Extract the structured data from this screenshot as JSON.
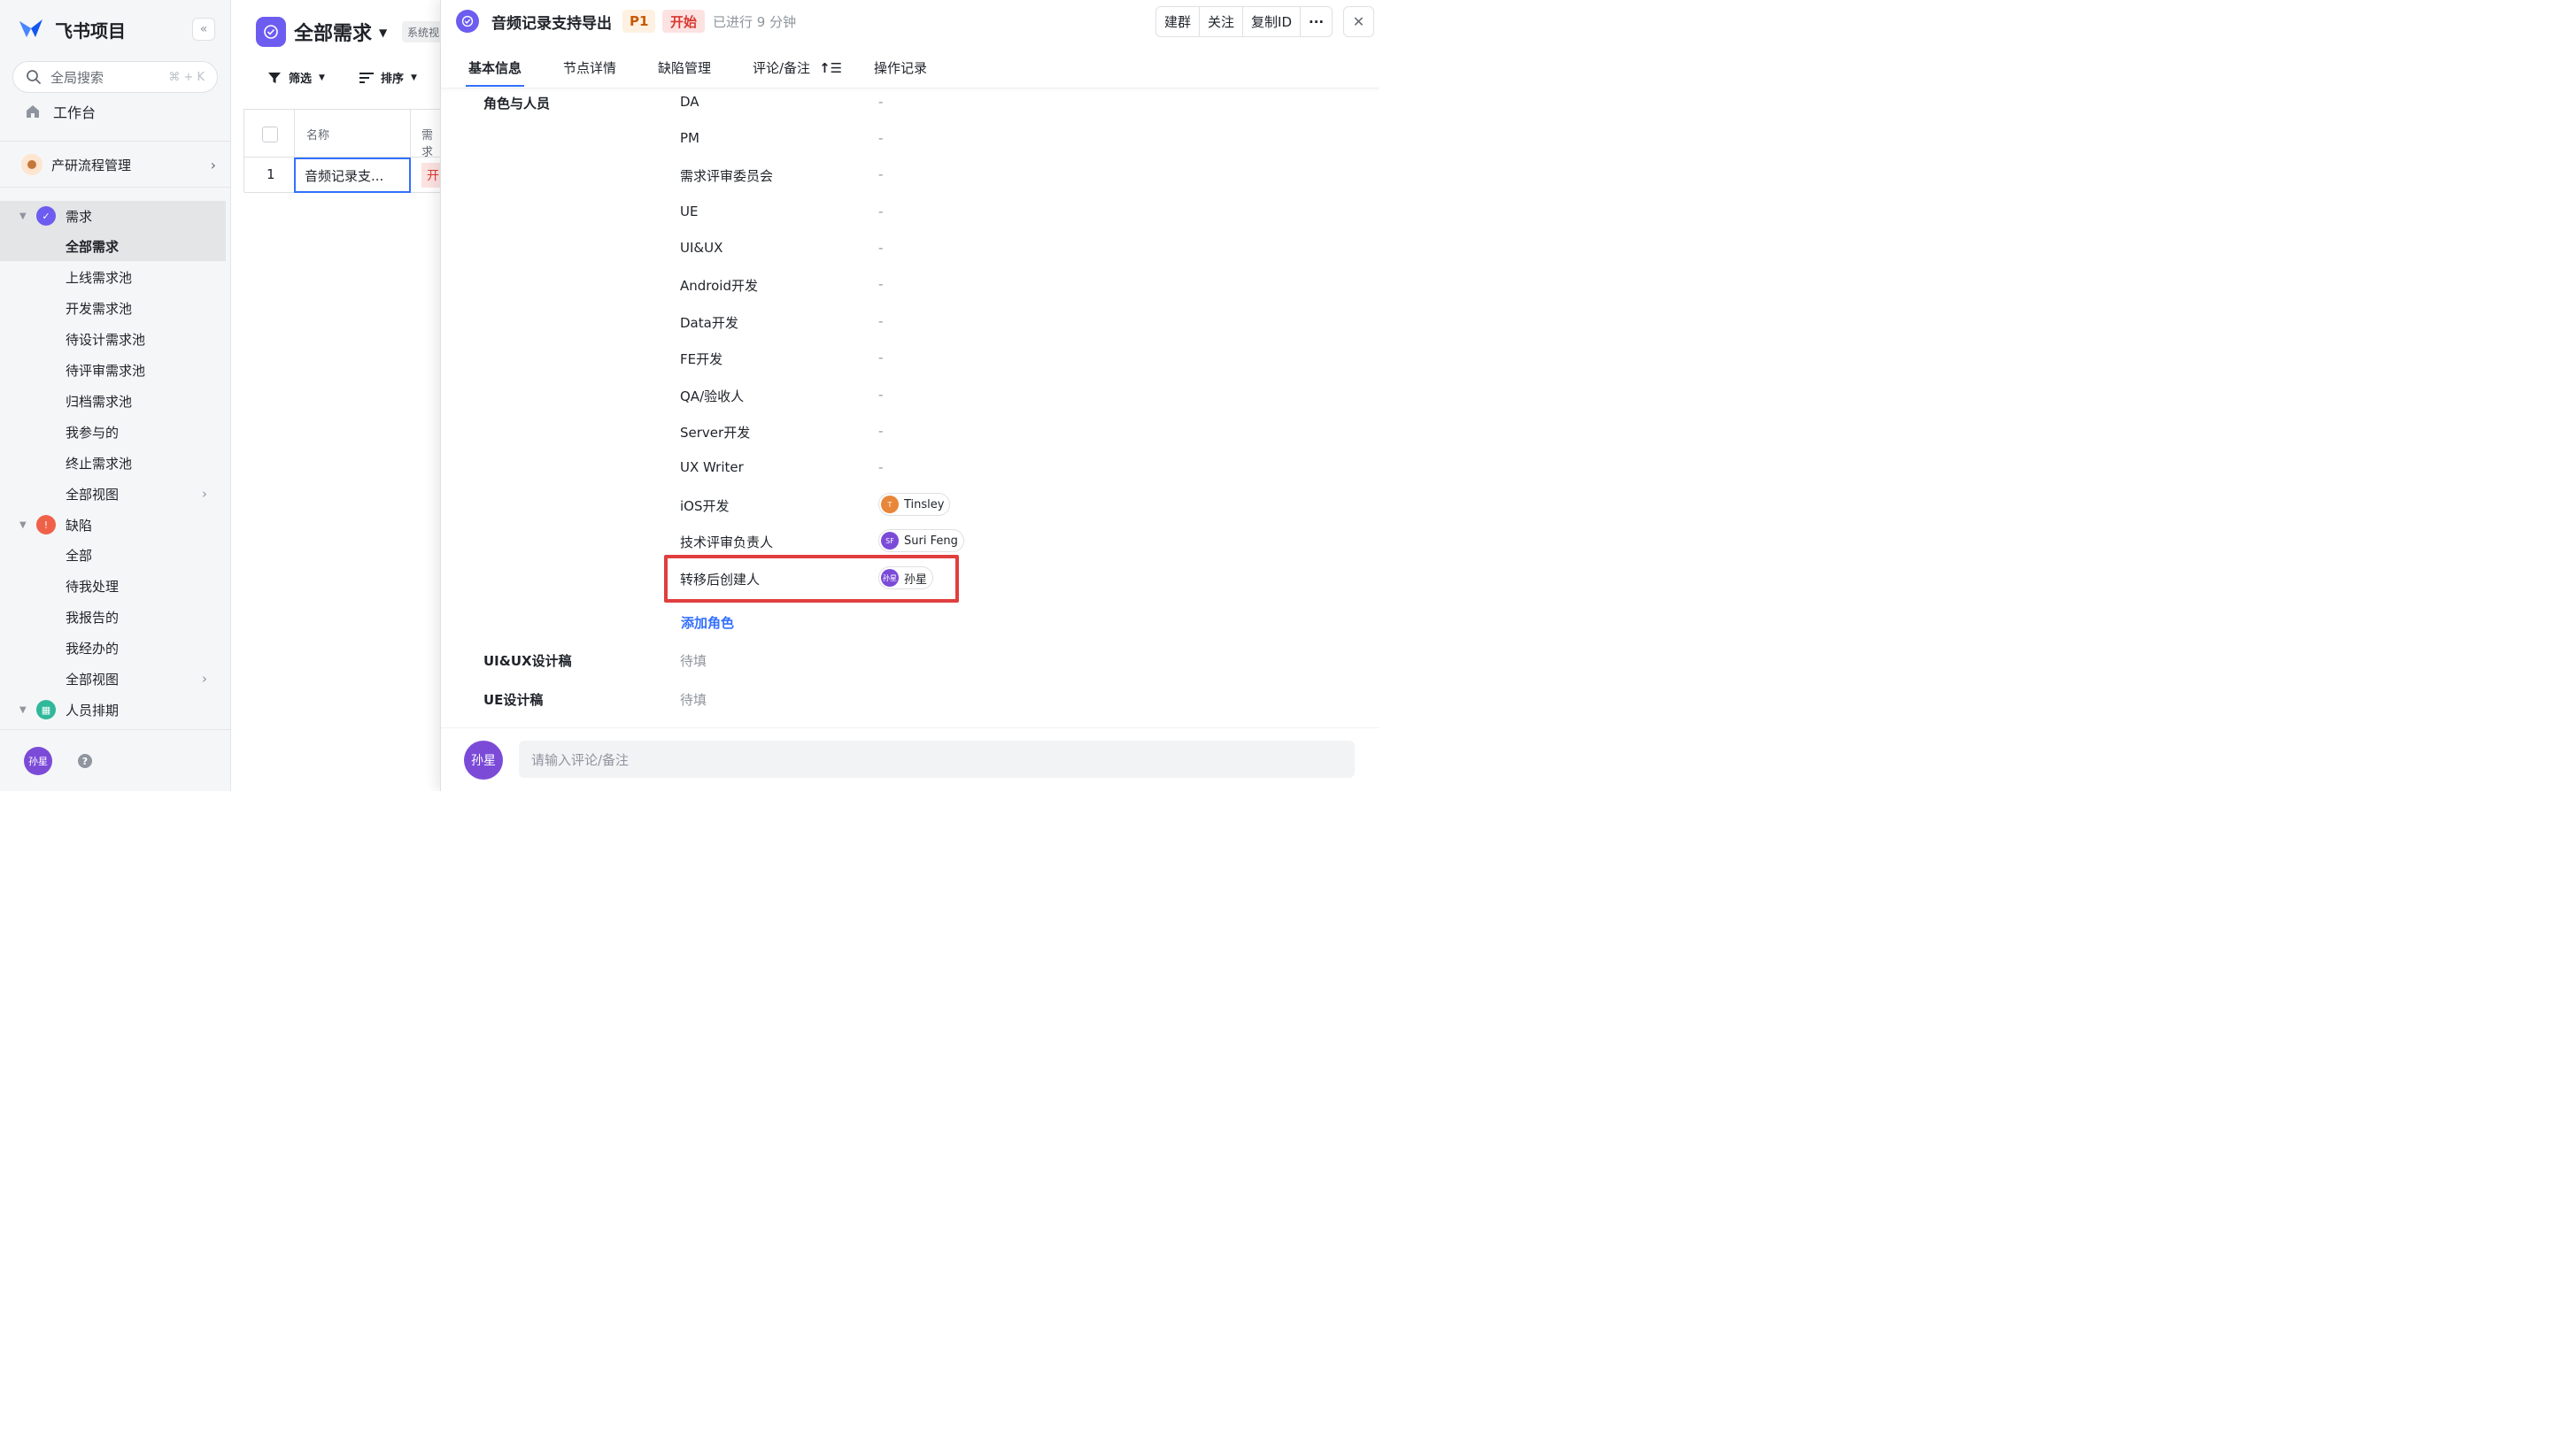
{
  "app": {
    "name": "飞书项目",
    "collapse_icon": "«"
  },
  "search": {
    "label": "全局搜索",
    "shortcut": "⌘ + K"
  },
  "workbench": "工作台",
  "space": {
    "name": "产研流程管理"
  },
  "sidebar": {
    "requirements": {
      "label": "需求",
      "color": "#6d5cf0",
      "items": [
        "全部需求",
        "上线需求池",
        "开发需求池",
        "待设计需求池",
        "待评审需求池",
        "归档需求池",
        "我参与的",
        "终止需求池",
        "全部视图"
      ]
    },
    "defects": {
      "label": "缺陷",
      "color": "#f0614a",
      "items": [
        "全部",
        "待我处理",
        "我报告的",
        "我经办的",
        "全部视图"
      ]
    },
    "scheduling": {
      "label": "人员排期",
      "color": "#2fb89a"
    }
  },
  "user": {
    "avatar_text": "孙星",
    "help_icon": "?"
  },
  "list": {
    "title": "全部需求",
    "badge": "系统视图",
    "filter_label": "筛选",
    "sort_label": "排序",
    "columns": [
      "名称",
      "需求"
    ],
    "rows": [
      {
        "index": "1",
        "name": "音频记录支...",
        "status_short": "开"
      }
    ]
  },
  "detail": {
    "title": "音频记录支持导出",
    "priority": "P1",
    "status": "开始",
    "elapsed": "已进行 9 分钟",
    "actions": [
      "建群",
      "关注",
      "复制ID",
      "···"
    ],
    "close": "✕",
    "tabs": [
      "基本信息",
      "节点详情",
      "缺陷管理",
      "评论/备注",
      "操作记录"
    ],
    "roles_section": "角色与人员",
    "roles": [
      {
        "name": "DA",
        "value": "-"
      },
      {
        "name": "PM",
        "value": "-"
      },
      {
        "name": "需求评审委员会",
        "value": "-"
      },
      {
        "name": "UE",
        "value": "-"
      },
      {
        "name": "UI&UX",
        "value": "-"
      },
      {
        "name": "Android开发",
        "value": "-"
      },
      {
        "name": "Data开发",
        "value": "-"
      },
      {
        "name": "FE开发",
        "value": "-"
      },
      {
        "name": "QA/验收人",
        "value": "-"
      },
      {
        "name": "Server开发",
        "value": "-"
      },
      {
        "name": "UX Writer",
        "value": "-"
      }
    ],
    "people_roles": [
      {
        "name": "iOS开发",
        "person": "Tinsley",
        "initials": "T",
        "color": "#e8863a"
      },
      {
        "name": "技术评审负责人",
        "person": "Suri Feng",
        "initials": "SF",
        "color": "#7b4bd8"
      },
      {
        "name": "转移后创建人",
        "person": "孙星",
        "initials": "孙星",
        "color": "#7b4bd8"
      }
    ],
    "add_role": "添加角色",
    "extra_fields": [
      {
        "label": "UI&UX设计稿",
        "value": "待填"
      },
      {
        "label": "UE设计稿",
        "value": "待填"
      }
    ],
    "comment": {
      "avatar_text": "孙星",
      "placeholder": "请输入评论/备注"
    }
  }
}
